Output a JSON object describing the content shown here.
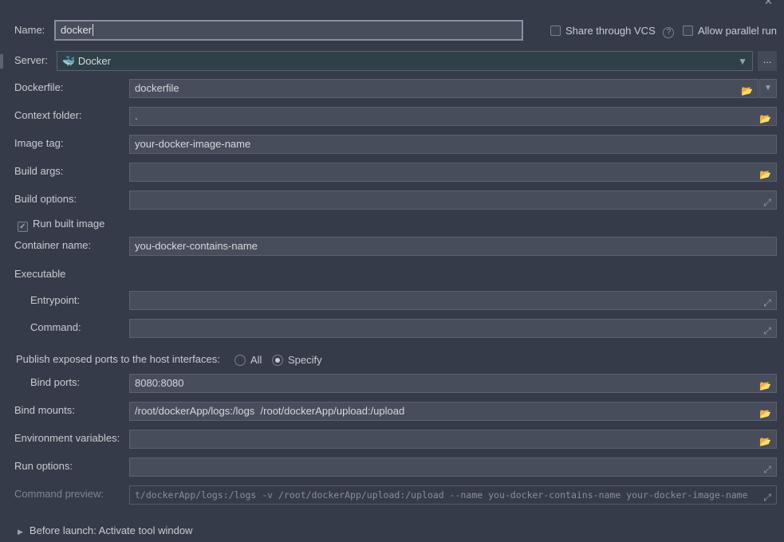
{
  "name": {
    "label": "Name:",
    "value": "docker"
  },
  "share_vcs": {
    "label": "Share through VCS",
    "checked": false
  },
  "allow_parallel": {
    "label": "Allow parallel run",
    "checked": false
  },
  "server": {
    "label": "Server:",
    "value": "Docker",
    "more": "..."
  },
  "dockerfile": {
    "label": "Dockerfile:",
    "value": "dockerfile"
  },
  "context_folder": {
    "label": "Context folder:",
    "value": "."
  },
  "image_tag": {
    "label": "Image tag:",
    "value": "your-docker-image-name"
  },
  "build_args": {
    "label": "Build args:",
    "value": ""
  },
  "build_options": {
    "label": "Build options:",
    "value": ""
  },
  "run_built_image": {
    "label": "Run built image",
    "checked": true
  },
  "container_name": {
    "label": "Container name:",
    "value": "you-docker-contains-name"
  },
  "executable": {
    "label": "Executable"
  },
  "entrypoint": {
    "label": "Entrypoint:",
    "value": ""
  },
  "command": {
    "label": "Command:",
    "value": ""
  },
  "publish": {
    "label": "Publish exposed ports to the host interfaces:",
    "options": [
      "All",
      "Specify"
    ],
    "selected": "Specify"
  },
  "bind_ports": {
    "label": "Bind ports:",
    "value": "8080:8080"
  },
  "bind_mounts": {
    "label": "Bind mounts:",
    "value": "/root/dockerApp/logs:/logs  /root/dockerApp/upload:/upload"
  },
  "env_vars": {
    "label": "Environment variables:",
    "value": ""
  },
  "run_options": {
    "label": "Run options:",
    "value": ""
  },
  "command_preview": {
    "label": "Command preview:",
    "value": "t/dockerApp/logs:/logs -v /root/dockerApp/upload:/upload --name you-docker-contains-name your-docker-image-name"
  },
  "before_launch": {
    "label": "Before launch: Activate tool window"
  }
}
